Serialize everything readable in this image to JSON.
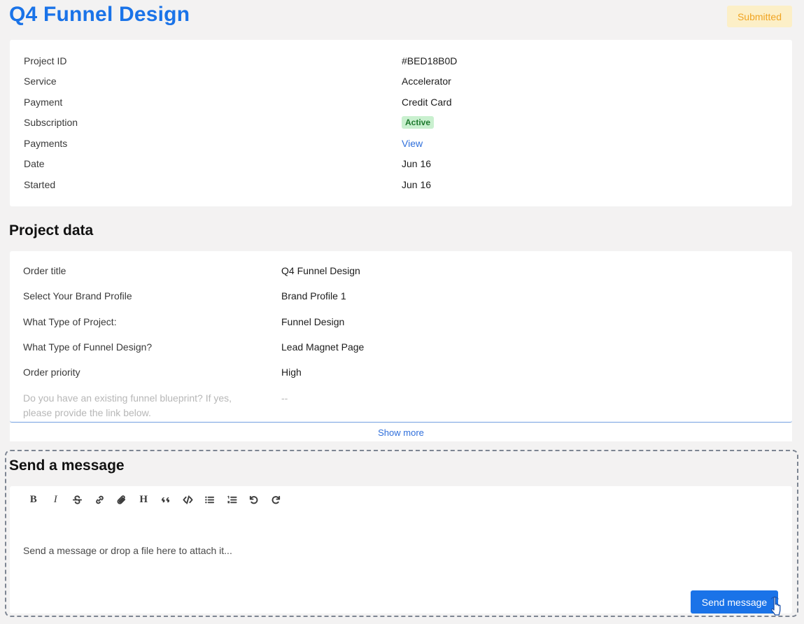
{
  "header": {
    "title": "Q4 Funnel Design",
    "status": "Submitted"
  },
  "info": {
    "rows": [
      {
        "label": "Project ID",
        "value": "#BED18B0D"
      },
      {
        "label": "Service",
        "value": "Accelerator"
      },
      {
        "label": "Payment",
        "value": "Credit Card"
      },
      {
        "label": "Subscription",
        "value": "Active"
      },
      {
        "label": "Payments",
        "value": "View"
      },
      {
        "label": "Date",
        "value": "Jun 16"
      },
      {
        "label": "Started",
        "value": "Jun 16"
      }
    ]
  },
  "project_data": {
    "title": "Project data",
    "rows": [
      {
        "label": "Order title",
        "value": "Q4 Funnel Design"
      },
      {
        "label": "Select Your Brand Profile",
        "value": "Brand Profile 1"
      },
      {
        "label": "What Type of Project:",
        "value": "Funnel Design"
      },
      {
        "label": "What Type of Funnel Design?",
        "value": "Lead Magnet Page"
      },
      {
        "label": "Order priority",
        "value": "High"
      },
      {
        "label": "Do you have an existing funnel blueprint? If yes, please provide the link below.",
        "value": "--"
      }
    ],
    "show_more_label": "Show more"
  },
  "message": {
    "title": "Send a message",
    "placeholder": "Send a message or drop a file here to attach it...",
    "send_label": "Send message",
    "toolbar": [
      {
        "name": "bold-icon",
        "glyph": "B"
      },
      {
        "name": "italic-icon",
        "glyph": "I"
      },
      {
        "name": "strikethrough-icon"
      },
      {
        "name": "link-icon"
      },
      {
        "name": "attachment-icon"
      },
      {
        "name": "heading-icon",
        "glyph": "H"
      },
      {
        "name": "quote-icon"
      },
      {
        "name": "code-icon"
      },
      {
        "name": "bullet-list-icon"
      },
      {
        "name": "numbered-list-icon"
      },
      {
        "name": "undo-icon"
      },
      {
        "name": "redo-icon"
      }
    ]
  },
  "colors": {
    "accent": "#1a73e8",
    "status_bg": "#fcefc7",
    "status_text": "#f0a422",
    "active_bg": "#c9f0cf",
    "active_text": "#1e7a2e"
  }
}
